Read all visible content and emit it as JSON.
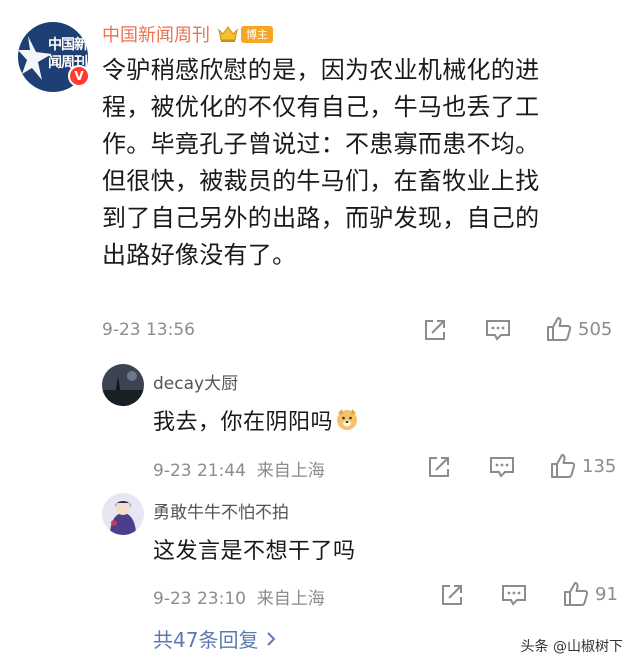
{
  "post": {
    "author": "中国新闻周刊",
    "avatar_text": "中国新闻周刊",
    "verified_mark": "V",
    "author_badge": "博主",
    "lines": [
      "令驴稍感欣慰的是，因为农业机械化的进",
      "程，被优化的不仅有自己，牛马也丢了工",
      "作。毕竟孔子曾说过：不患寡而患不均。",
      "但很快，被裁员的牛马们，在畜牧业上找",
      "到了自己另外的出路，而驴发现，自己的",
      "出路好像没有了。"
    ],
    "time": "9-23 13:56",
    "likes": "505"
  },
  "replies": [
    {
      "name": "decay大厨",
      "text": "我去，你在阴阳吗",
      "time": "9-23 21:44",
      "location": "来自上海",
      "likes": "135"
    },
    {
      "name": "勇敢牛牛不怕不拍",
      "text": "这发言是不想干了吗",
      "time": "9-23 23:10",
      "location": "来自上海",
      "likes": "91"
    }
  ],
  "more_replies": "共47条回复",
  "watermark": "头条 @山椒树下",
  "colors": {
    "author": "#eb7350",
    "link": "#5b7bb0",
    "meta": "#8c8c8c",
    "badge": "#f5a623",
    "verified": "#ff3b30"
  },
  "icons": [
    "share-icon",
    "comment-icon",
    "thumbs-up-icon",
    "crown-icon",
    "doge-emoji-icon",
    "chevron-right-icon"
  ]
}
